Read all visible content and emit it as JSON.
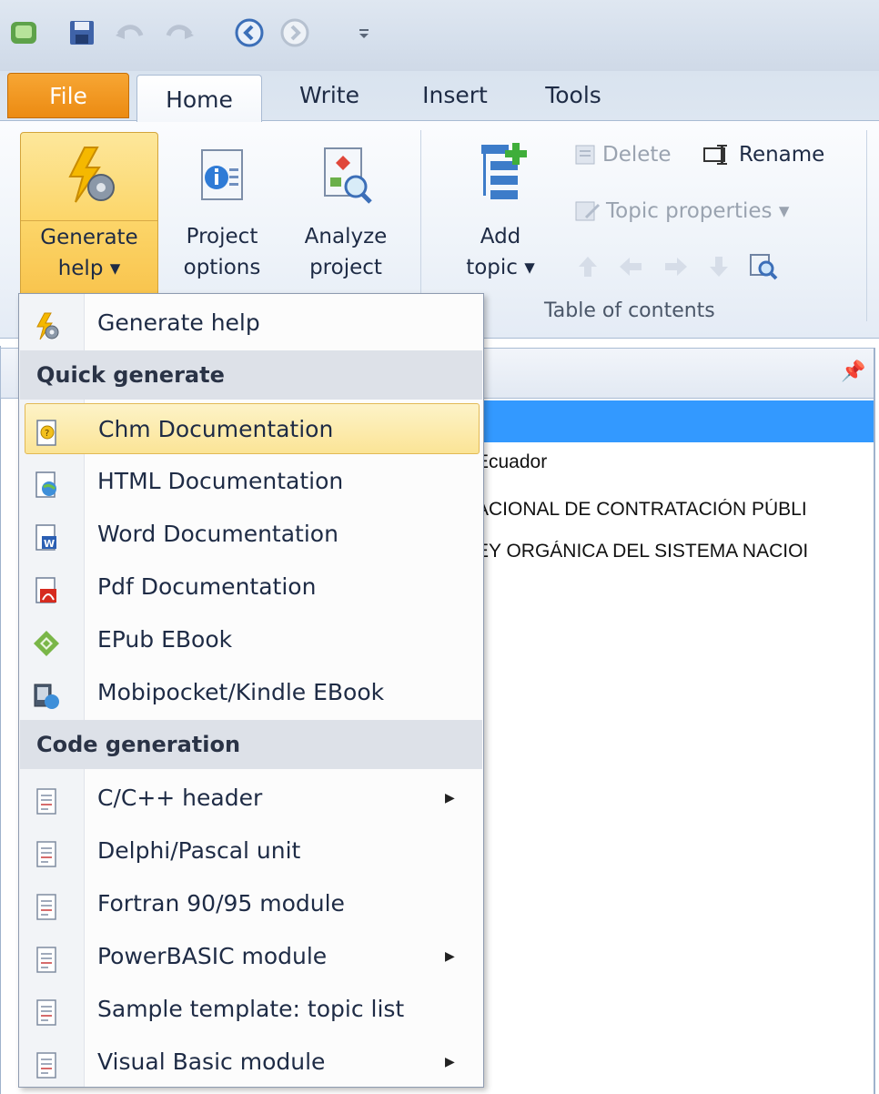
{
  "qat": {
    "icons": [
      "app-icon",
      "save-icon",
      "undo-icon",
      "redo-icon",
      "back-icon",
      "forward-icon",
      "customize-qat-icon"
    ]
  },
  "tabs": [
    "File",
    "Home",
    "Write",
    "Insert",
    "Tools"
  ],
  "ribbon": {
    "generate_help": [
      "Generate",
      "help ▾"
    ],
    "project_options": [
      "Project",
      "options"
    ],
    "analyze_project": [
      "Analyze",
      "project"
    ],
    "add_topic": [
      "Add",
      "topic ▾"
    ],
    "delete": "Delete",
    "rename": "Rename",
    "topic_properties": "Topic properties ▾",
    "group_toc": "Table of contents"
  },
  "panel": {
    "lines": [
      "Ecuador",
      "ACIONAL DE CONTRATACIÓN PÚBLI",
      "EY ORGÁNICA DEL SISTEMA NACIOI",
      ")"
    ]
  },
  "menu": {
    "generate_help": "Generate help",
    "quick_generate": "Quick generate",
    "items_quick": [
      "Chm Documentation",
      "HTML Documentation",
      "Word Documentation",
      "Pdf Documentation",
      "EPub EBook",
      "Mobipocket/Kindle EBook"
    ],
    "code_generation": "Code generation",
    "items_code": [
      "C/C++ header",
      "Delphi/Pascal unit",
      "Fortran 90/95 module",
      "PowerBASIC module",
      "Sample template: topic list",
      "Visual Basic module"
    ],
    "submenu_arrow": "▶"
  },
  "colors": {
    "accent_file_tab": "#ec8b12",
    "highlight": "#fbe496",
    "selection": "#3399ff"
  }
}
